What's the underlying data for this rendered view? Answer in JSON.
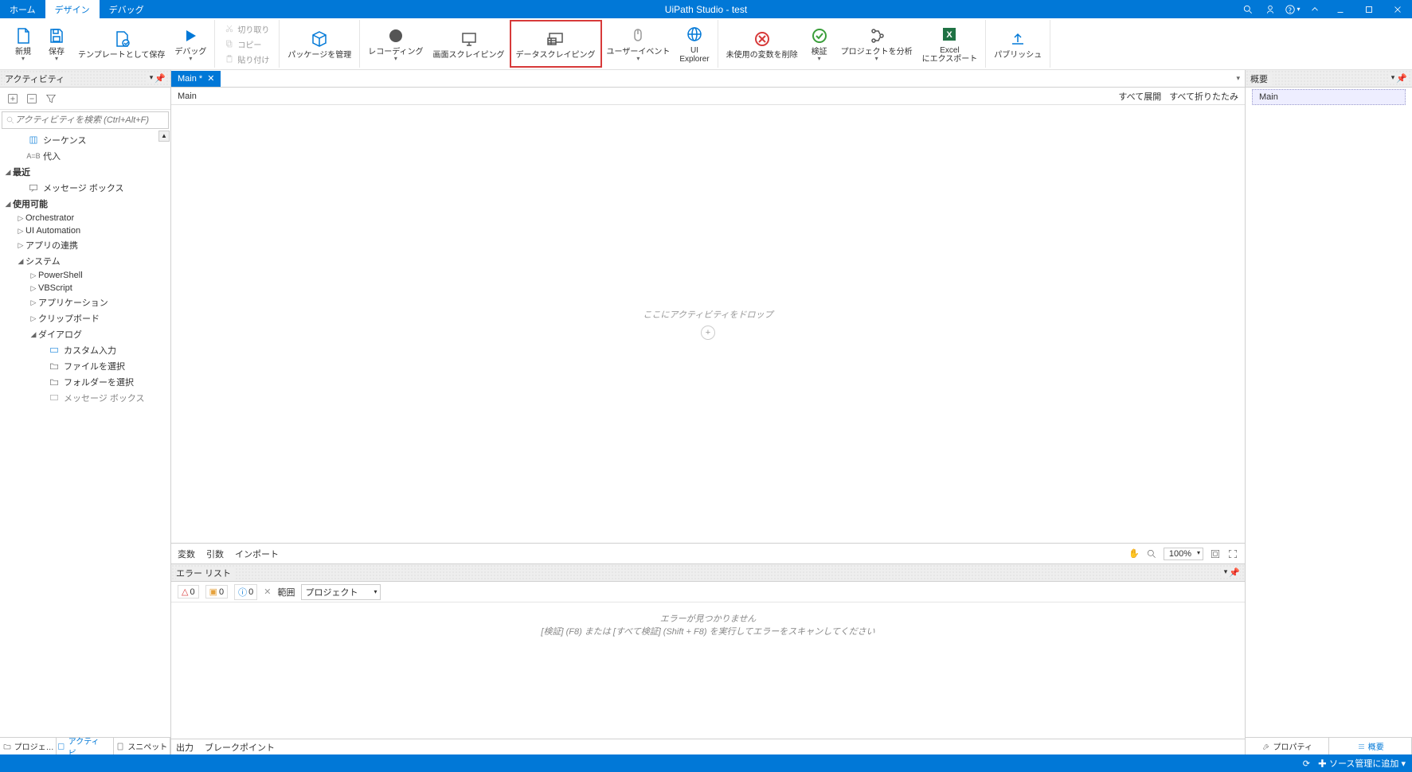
{
  "title": "UiPath Studio - test",
  "menuTabs": {
    "home": "ホーム",
    "design": "デザイン",
    "debug": "デバッグ"
  },
  "ribbon": {
    "new": "新規",
    "save": "保存",
    "saveTemplate": "テンプレートとして保存",
    "debug": "デバッグ",
    "cut": "切り取り",
    "copy": "コピー",
    "paste": "貼り付け",
    "pkg": "パッケージを管理",
    "rec": "レコーディング",
    "screen": "画面スクレイピング",
    "data": "データスクレイピング",
    "user": "ユーザーイベント",
    "uiexp": "UI\nExplorer",
    "unused": "未使用の変数を削除",
    "validate": "検証",
    "analyze": "プロジェクトを分析",
    "excel": "Excel\nにエクスポート",
    "publish": "パブリッシュ"
  },
  "activities": {
    "title": "アクティビティ",
    "searchPlaceholder": "アクティビティを検索 (Ctrl+Alt+F)",
    "items": {
      "sequence": "シーケンス",
      "assign": "代入",
      "recent": "最近",
      "msgbox": "メッセージ ボックス",
      "available": "使用可能",
      "orchestrator": "Orchestrator",
      "uiauto": "UI Automation",
      "appint": "アプリの連携",
      "system": "システム",
      "powershell": "PowerShell",
      "vbscript": "VBScript",
      "application": "アプリケーション",
      "clipboard": "クリップボード",
      "dialog": "ダイアログ",
      "custominput": "カスタム入力",
      "selectfile": "ファイルを選択",
      "selectfolder": "フォルダーを選択",
      "msgbox2": "メッセージ ボックス"
    },
    "tabs": {
      "project": "プロジェ…",
      "activity": "アクティビ…",
      "snippet": "スニペット"
    }
  },
  "doc": {
    "tab": "Main *",
    "breadcrumb": "Main",
    "expandAll": "すべて展開",
    "collapseAll": "すべて折りたたみ",
    "dropHint": "ここにアクティビティをドロップ"
  },
  "designerFooter": {
    "vars": "変数",
    "args": "引数",
    "imports": "インポート",
    "zoom": "100%"
  },
  "outline": {
    "title": "概要",
    "root": "Main"
  },
  "rightTabs": {
    "props": "プロパティ",
    "outline": "概要"
  },
  "errors": {
    "title": "エラー リスト",
    "errCount": "0",
    "warnCount": "0",
    "infoCount": "0",
    "scopeLabel": "範囲",
    "scopeValue": "プロジェクト",
    "noErrors": "エラーが見つかりません",
    "hint": "[検証] (F8) または [すべて検証] (Shift + F8) を実行してエラーをスキャンしてください"
  },
  "bottomTabs": {
    "output": "出力",
    "breakpoints": "ブレークポイント"
  },
  "status": {
    "addSource": "ソース管理に追加"
  }
}
